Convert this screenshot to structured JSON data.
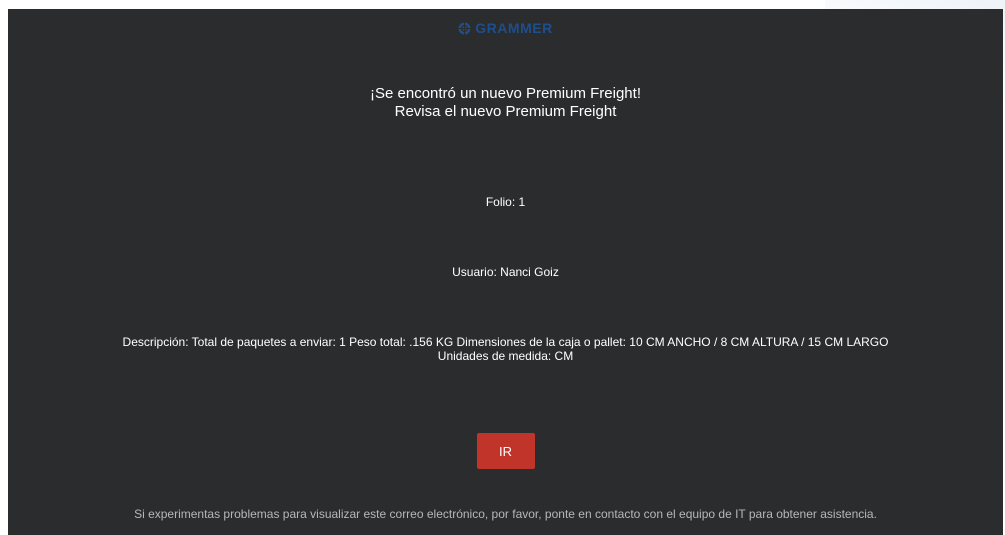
{
  "logo": {
    "text": "GRAMMER",
    "icon": "grammer-logo-icon",
    "color": "#1f4e8c"
  },
  "header": {
    "line1": "¡Se encontró un nuevo Premium Freight!",
    "line2": "Revisa el nuevo Premium Freight"
  },
  "details": {
    "folio": "Folio: 1",
    "usuario": "Usuario: Nanci Goiz",
    "descripcion_line1": "Descripción: Total de paquetes a enviar: 1 Peso total: .156 KG Dimensiones de la caja o pallet: 10 CM ANCHO / 8 CM ALTURA / 15 CM LARGO",
    "descripcion_line2": "Unidades de medida: CM"
  },
  "action": {
    "button_label": "IR",
    "button_color": "#c0342a"
  },
  "footer": {
    "text": "Si experimentas problemas para visualizar este correo electrónico, por favor, ponte en contacto con el equipo de IT para obtener asistencia."
  },
  "colors": {
    "panel_bg": "#2b2c2d",
    "text": "#ffffff",
    "footer_text": "#b7b7b7"
  }
}
